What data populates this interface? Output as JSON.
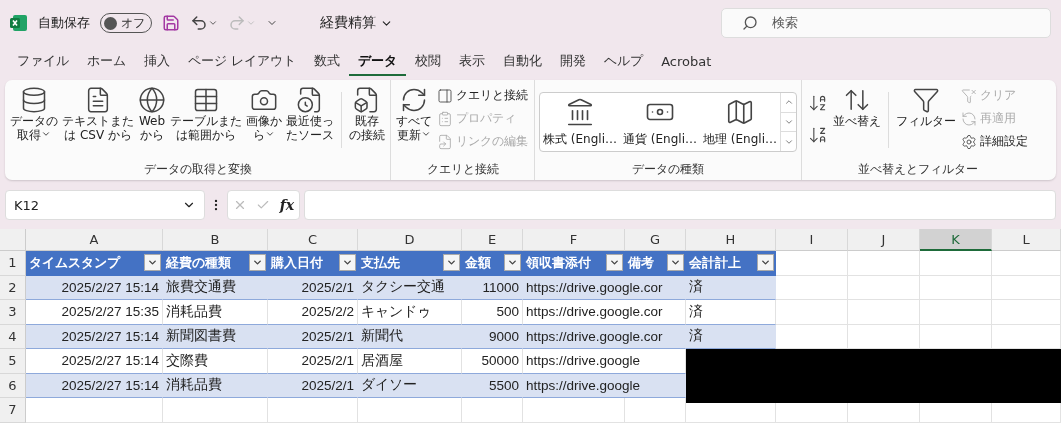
{
  "title_bar": {
    "autosave_label": "自動保存",
    "autosave_toggle": {
      "label": "オフ",
      "on": false
    },
    "filename": "経費精算",
    "search": {
      "placeholder": "検索"
    }
  },
  "tabs": [
    {
      "label": "ファイル",
      "selected": false
    },
    {
      "label": "ホーム",
      "selected": false
    },
    {
      "label": "挿入",
      "selected": false
    },
    {
      "label": "ページ レイアウト",
      "selected": false
    },
    {
      "label": "数式",
      "selected": false
    },
    {
      "label": "データ",
      "selected": true
    },
    {
      "label": "校閲",
      "selected": false
    },
    {
      "label": "表示",
      "selected": false
    },
    {
      "label": "自動化",
      "selected": false
    },
    {
      "label": "開発",
      "selected": false
    },
    {
      "label": "ヘルプ",
      "selected": false
    },
    {
      "label": "Acrobat",
      "selected": false
    }
  ],
  "ribbon_groups": [
    {
      "label": "データの取得と変換",
      "buttons": [
        {
          "kind": "large",
          "lines": [
            "データの",
            "取得"
          ],
          "has_menu": true,
          "disabled": false
        },
        {
          "kind": "large",
          "lines": [
            "テキストまた",
            "は CSV から"
          ],
          "has_menu": false,
          "disabled": false
        },
        {
          "kind": "large",
          "lines": [
            "Web",
            "から"
          ],
          "has_menu": false,
          "disabled": false
        },
        {
          "kind": "large",
          "lines": [
            "テーブルまた",
            "は範囲から"
          ],
          "has_menu": false,
          "disabled": false
        },
        {
          "kind": "large",
          "lines": [
            "画像か",
            "ら"
          ],
          "has_menu": true,
          "disabled": false
        },
        {
          "kind": "large",
          "lines": [
            "最近使っ",
            "たソース"
          ],
          "has_menu": false,
          "disabled": false
        },
        {
          "kind": "separator"
        },
        {
          "kind": "large",
          "lines": [
            "既存",
            "の接続"
          ],
          "has_menu": false,
          "disabled": false
        }
      ]
    },
    {
      "label": "クエリと接続",
      "buttons": [
        {
          "kind": "large",
          "lines": [
            "すべて",
            "更新"
          ],
          "has_menu": true,
          "disabled": false
        },
        {
          "kind": "small",
          "lines": [
            "クエリと接続"
          ],
          "disabled": false
        },
        {
          "kind": "small",
          "lines": [
            "プロパティ"
          ],
          "disabled": true
        },
        {
          "kind": "small",
          "lines": [
            "リンクの編集"
          ],
          "disabled": true
        }
      ]
    },
    {
      "label": "データの種類",
      "buttons": [
        {
          "kind": "gallery",
          "lines": [
            "株式 (Engli…"
          ]
        },
        {
          "kind": "gallery",
          "lines": [
            "通貨 (Engli…"
          ]
        },
        {
          "kind": "gallery",
          "lines": [
            "地理 (Engli…"
          ]
        }
      ]
    },
    {
      "label": "並べ替えとフィルター",
      "buttons": [
        {
          "kind": "icon",
          "disabled": false
        },
        {
          "kind": "icon",
          "disabled": false
        },
        {
          "kind": "large",
          "lines": [
            "並べ替え"
          ],
          "has_menu": false,
          "disabled": false
        },
        {
          "kind": "separator"
        },
        {
          "kind": "large",
          "lines": [
            "フィルター"
          ],
          "has_menu": false,
          "disabled": false
        },
        {
          "kind": "small",
          "lines": [
            "クリア"
          ],
          "disabled": true
        },
        {
          "kind": "small",
          "lines": [
            "再適用"
          ],
          "disabled": true
        },
        {
          "kind": "small",
          "lines": [
            "詳細設定"
          ],
          "disabled": false
        }
      ]
    }
  ],
  "formula_bar": {
    "name_box": "K12",
    "function_label": "fx"
  },
  "sheet": {
    "columns": [
      {
        "letter": "A",
        "selected": false
      },
      {
        "letter": "B",
        "selected": false
      },
      {
        "letter": "C",
        "selected": false
      },
      {
        "letter": "D",
        "selected": false
      },
      {
        "letter": "E",
        "selected": false
      },
      {
        "letter": "F",
        "selected": false
      },
      {
        "letter": "G",
        "selected": false
      },
      {
        "letter": "H",
        "selected": false
      },
      {
        "letter": "I",
        "selected": false
      },
      {
        "letter": "J",
        "selected": false
      },
      {
        "letter": "K",
        "selected": true
      },
      {
        "letter": "L",
        "selected": false
      }
    ],
    "row_numbers": [
      "1",
      "2",
      "3",
      "4",
      "5",
      "6",
      "7"
    ]
  },
  "table": {
    "columns": [
      {
        "title": "タイムスタンプ",
        "kind": "number"
      },
      {
        "title": "経費の種類",
        "kind": "text"
      },
      {
        "title": "購入日付",
        "kind": "number"
      },
      {
        "title": "支払先",
        "kind": "text"
      },
      {
        "title": "金額",
        "kind": "number"
      },
      {
        "title": "領収書添付",
        "kind": "text"
      },
      {
        "title": "備考"
      },
      {
        "title": "会計計上",
        "kind": "text"
      }
    ],
    "rows": [
      {
        "cells": [
          "2025/2/27 15:14",
          "旅費交通費",
          "2025/2/1",
          "タクシー交通",
          "11000",
          "https://drive.google.cor",
          null,
          "済"
        ]
      },
      {
        "cells": [
          "2025/2/27 15:35",
          "消耗品費",
          "2025/2/2",
          "キャンドゥ",
          "500",
          "https://drive.google.cor",
          null,
          "済"
        ]
      },
      {
        "cells": [
          "2025/2/27 15:14",
          "新聞図書費",
          "2025/2/1",
          "新聞代",
          "9000",
          "https://drive.google.cor",
          null,
          "済"
        ]
      },
      {
        "cells": [
          "2025/2/27 15:14",
          "交際費",
          "2025/2/1",
          "居酒屋",
          "50000",
          "https://drive.google"
        ]
      },
      {
        "cells": [
          "2025/2/27 15:14",
          "消耗品費",
          "2025/2/1",
          "ダイソー",
          "5500",
          "https://drive.google"
        ]
      }
    ]
  }
}
